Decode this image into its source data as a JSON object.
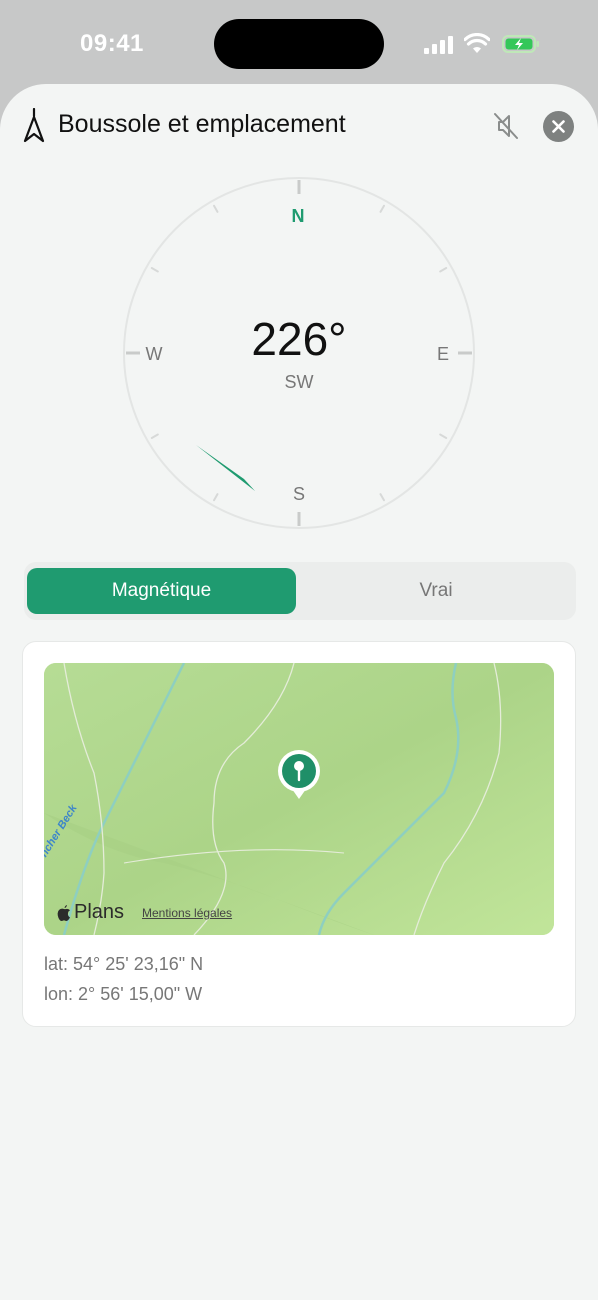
{
  "status_bar": {
    "time": "09:41"
  },
  "header": {
    "title": "Boussole et emplacement",
    "icons": [
      "compass-needle-icon",
      "speaker-muted-icon",
      "close-icon"
    ]
  },
  "compass": {
    "heading": "226°",
    "direction": "SW",
    "cardinals": {
      "north": "N",
      "east": "E",
      "south": "S",
      "west": "W"
    },
    "accent_color": "#1f9b70"
  },
  "mode_toggle": {
    "options": [
      "Magnétique",
      "Vrai"
    ],
    "selected": "Magnétique"
  },
  "location": {
    "map_attribution": "Plans",
    "legal_link": "Mentions légales",
    "map_label": "ncher Beck",
    "latitude": "lat: 54° 25' 23,16\" N",
    "longitude": "lon: 2° 56' 15,00\" W"
  }
}
